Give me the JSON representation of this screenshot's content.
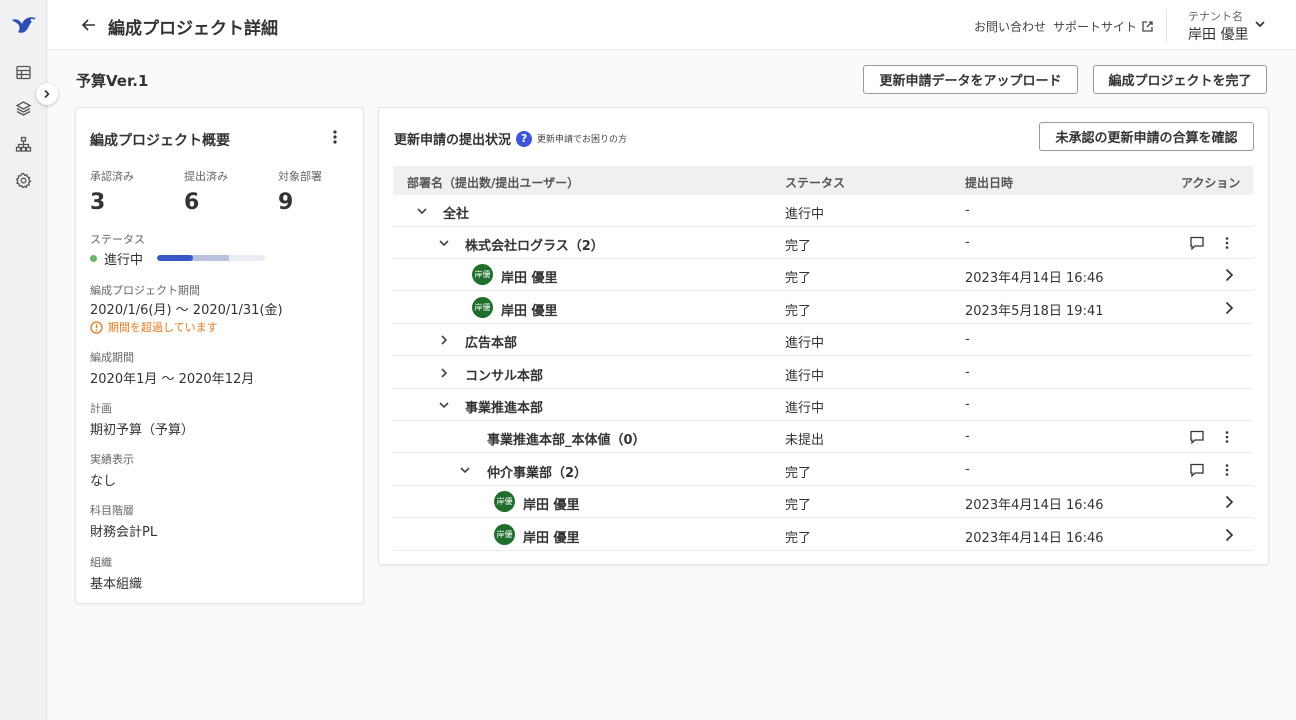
{
  "header": {
    "title": "編成プロジェクト詳細",
    "contact": "お問い合わせ",
    "support": "サポートサイト",
    "tenant_label": "テナント名",
    "tenant_user": "岸田 優里"
  },
  "page": {
    "budget_title": "予算Ver.1",
    "upload_button": "更新申請データをアップロード",
    "complete_button": "編成プロジェクトを完了"
  },
  "overview": {
    "title": "編成プロジェクト概要",
    "stats": [
      {
        "label": "承認済み",
        "value": "3"
      },
      {
        "label": "提出済み",
        "value": "6"
      },
      {
        "label": "対象部署",
        "value": "9"
      }
    ],
    "status_label": "ステータス",
    "status_value": "進行中",
    "progress": {
      "done": 0.33,
      "submitted": 0.67
    },
    "period_label": "編成プロジェクト期間",
    "period_value": "2020/1/6(月) 〜 2020/1/31(金)",
    "warning": "期間を超過しています",
    "term_label": "編成期間",
    "term_value": "2020年1月 〜 2020年12月",
    "plan_label": "計画",
    "plan_value": "期初予算（予算）",
    "actual_label": "実績表示",
    "actual_value": "なし",
    "account_label": "科目階層",
    "account_value": "財務会計PL",
    "org_label": "組織",
    "org_value": "基本組織"
  },
  "submissions": {
    "title": "更新申請の提出状況",
    "help_text": "更新申請でお困りの方",
    "confirm_button": "未承認の更新申請の合算を確認",
    "columns": [
      "部署名（提出数/提出ユーザー）",
      "ステータス",
      "提出日時",
      "アクション"
    ],
    "rows": [
      {
        "name": "全社",
        "status": "進行中",
        "date": "-"
      },
      {
        "name": "株式会社ログラス（2）",
        "status": "完了",
        "date": "-"
      },
      {
        "name": "岸田 優里",
        "avatar": "岸優",
        "status": "完了",
        "date": "2023年4月14日 16:46"
      },
      {
        "name": "岸田 優里",
        "avatar": "岸優",
        "status": "完了",
        "date": "2023年5月18日 19:41"
      },
      {
        "name": "広告本部",
        "status": "進行中",
        "date": "-"
      },
      {
        "name": "コンサル本部",
        "status": "進行中",
        "date": "-"
      },
      {
        "name": "事業推進本部",
        "status": "進行中",
        "date": "-"
      },
      {
        "name": "事業推進本部_本体値（0）",
        "status": "未提出",
        "date": "-"
      },
      {
        "name": "仲介事業部（2）",
        "status": "完了",
        "date": "-"
      },
      {
        "name": "岸田 優里",
        "avatar": "岸優",
        "status": "完了",
        "date": "2023年4月14日 16:46"
      },
      {
        "name": "岸田 優里",
        "avatar": "岸優",
        "status": "完了",
        "date": "2023年4月14日 16:46"
      }
    ]
  },
  "colors": {
    "accent": "#3c56d8",
    "warning": "#e07b1f",
    "status_green": "#6bb36b",
    "avatar_green": "#1f6e2b"
  }
}
